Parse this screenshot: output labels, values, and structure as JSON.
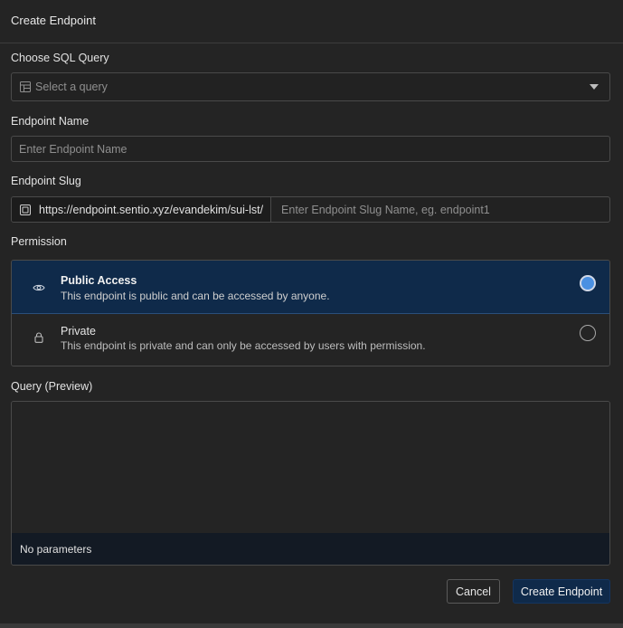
{
  "dialog": {
    "title": "Create Endpoint"
  },
  "sql_query": {
    "label": "Choose SQL Query",
    "placeholder": "Select a query",
    "icon": "table-icon"
  },
  "endpoint_name": {
    "label": "Endpoint Name",
    "placeholder": "Enter Endpoint Name",
    "value": ""
  },
  "endpoint_slug": {
    "label": "Endpoint Slug",
    "prefix_url": "https://endpoint.sentio.xyz/evandekim/sui-lst/",
    "placeholder": "Enter Endpoint Slug Name, eg. endpoint1",
    "value": "",
    "icon": "copy-icon"
  },
  "permission": {
    "label": "Permission",
    "options": [
      {
        "title": "Public Access",
        "description": "This endpoint is public and can be accessed by anyone.",
        "icon": "eye-icon",
        "selected": true
      },
      {
        "title": "Private",
        "description": "This endpoint is private and can only be accessed by users with permission.",
        "icon": "lock-icon",
        "selected": false
      }
    ]
  },
  "query_preview": {
    "label": "Query (Preview)",
    "parameters_text": "No parameters"
  },
  "actions": {
    "cancel_label": "Cancel",
    "create_label": "Create Endpoint"
  },
  "colors": {
    "background": "#242424",
    "selected_option": "#0f2a4a",
    "radio_accent": "#4a90e2",
    "primary_button": "#0f2a4a"
  }
}
